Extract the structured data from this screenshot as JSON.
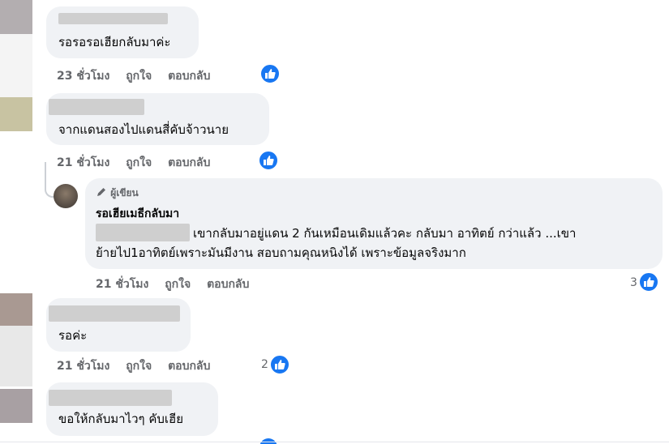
{
  "comments": [
    {
      "text": "รอรอรอเฮียกลับมาค่ะ",
      "time": "23 ชั่วโมง"
    },
    {
      "text": "จากแดนสองไปแดนสี่คับจ้าวนาย",
      "time": "21 ชั่วโมง"
    },
    {
      "text": "รอค่ะ",
      "time": "21 ชั่วโมง",
      "reaction_count": "2"
    },
    {
      "text": "ขอให้กลับมาไวๆ คับเฮีย",
      "time": ""
    }
  ],
  "reply": {
    "author_badge": "ผู้เขียน",
    "author_name": "รอเฮียเมธีกลับมา",
    "line1": "เขากลับมาอยู่แดน 2 กันเหมือนเดิมแล้วคะ กลับมา อาทิตย์ กว่าแล้ว ...เขา",
    "line2": "ย้ายไป1อาทิตย์เพราะมันมีงาน สอบถามคุณหนิงได้ เพราะข้อมูลจริงมาก",
    "time": "21 ชั่วโมง",
    "reaction_count": "3"
  },
  "actions": {
    "like": "ถูกใจ",
    "reply": "ตอบกลับ"
  },
  "colors": {
    "accent": "#1877f2",
    "bubble": "#f0f2f5",
    "meta": "#65676b"
  },
  "icons": {
    "like": "thumbs-up-icon",
    "badge": "pencil-icon"
  }
}
